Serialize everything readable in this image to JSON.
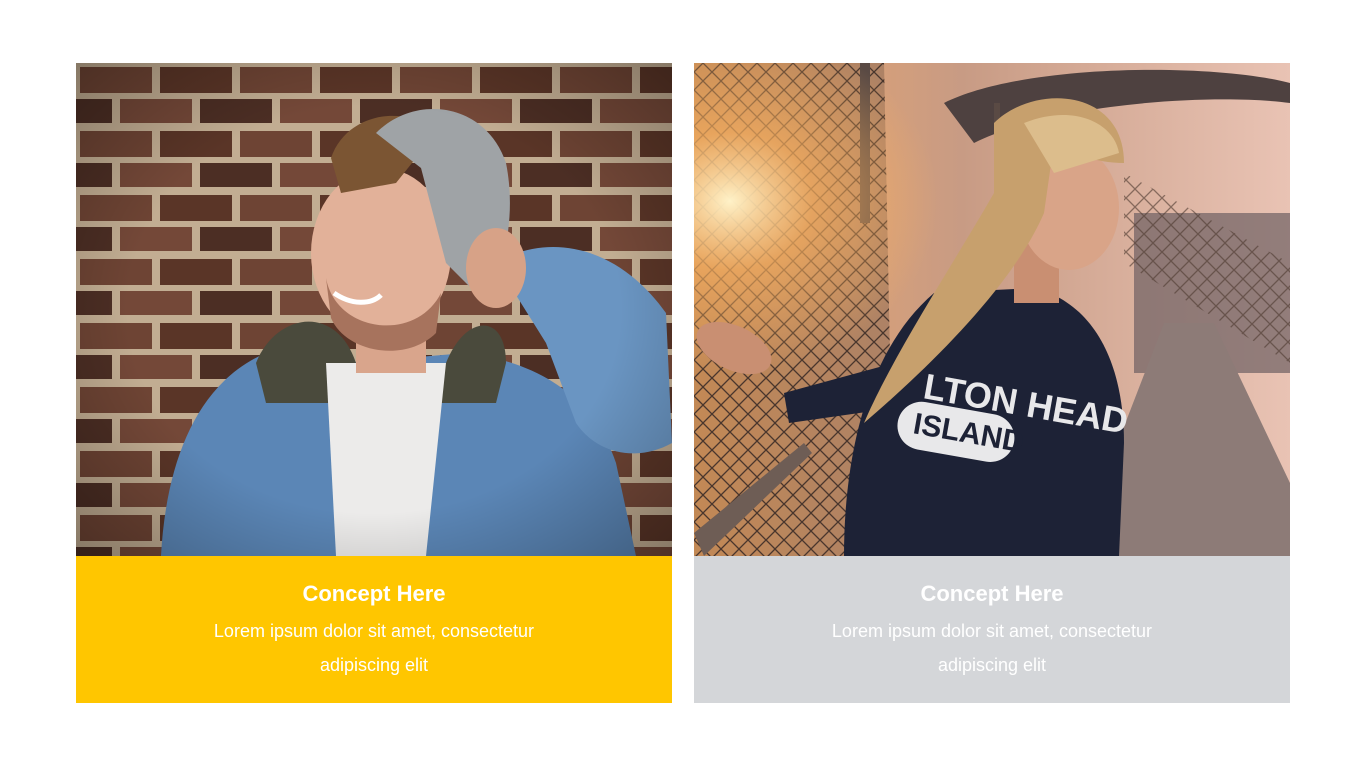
{
  "colors": {
    "accent_yellow": "#ffc600",
    "accent_gray": "#d4d6d9",
    "caption_text": "#ffffff",
    "background": "#ffffff"
  },
  "cards": [
    {
      "image": "man-in-beanie-and-denim-jacket-photo",
      "title": "Concept Here",
      "body": "Lorem ipsum dolor sit amet, consectetur adipiscing elit"
    },
    {
      "image": "woman-on-fenced-bridge-at-sunset-photo",
      "image_text": "LTON HEAD ISLAND",
      "title": "Concept Here",
      "body": "Lorem ipsum dolor sit amet, consectetur adipiscing elit"
    }
  ]
}
